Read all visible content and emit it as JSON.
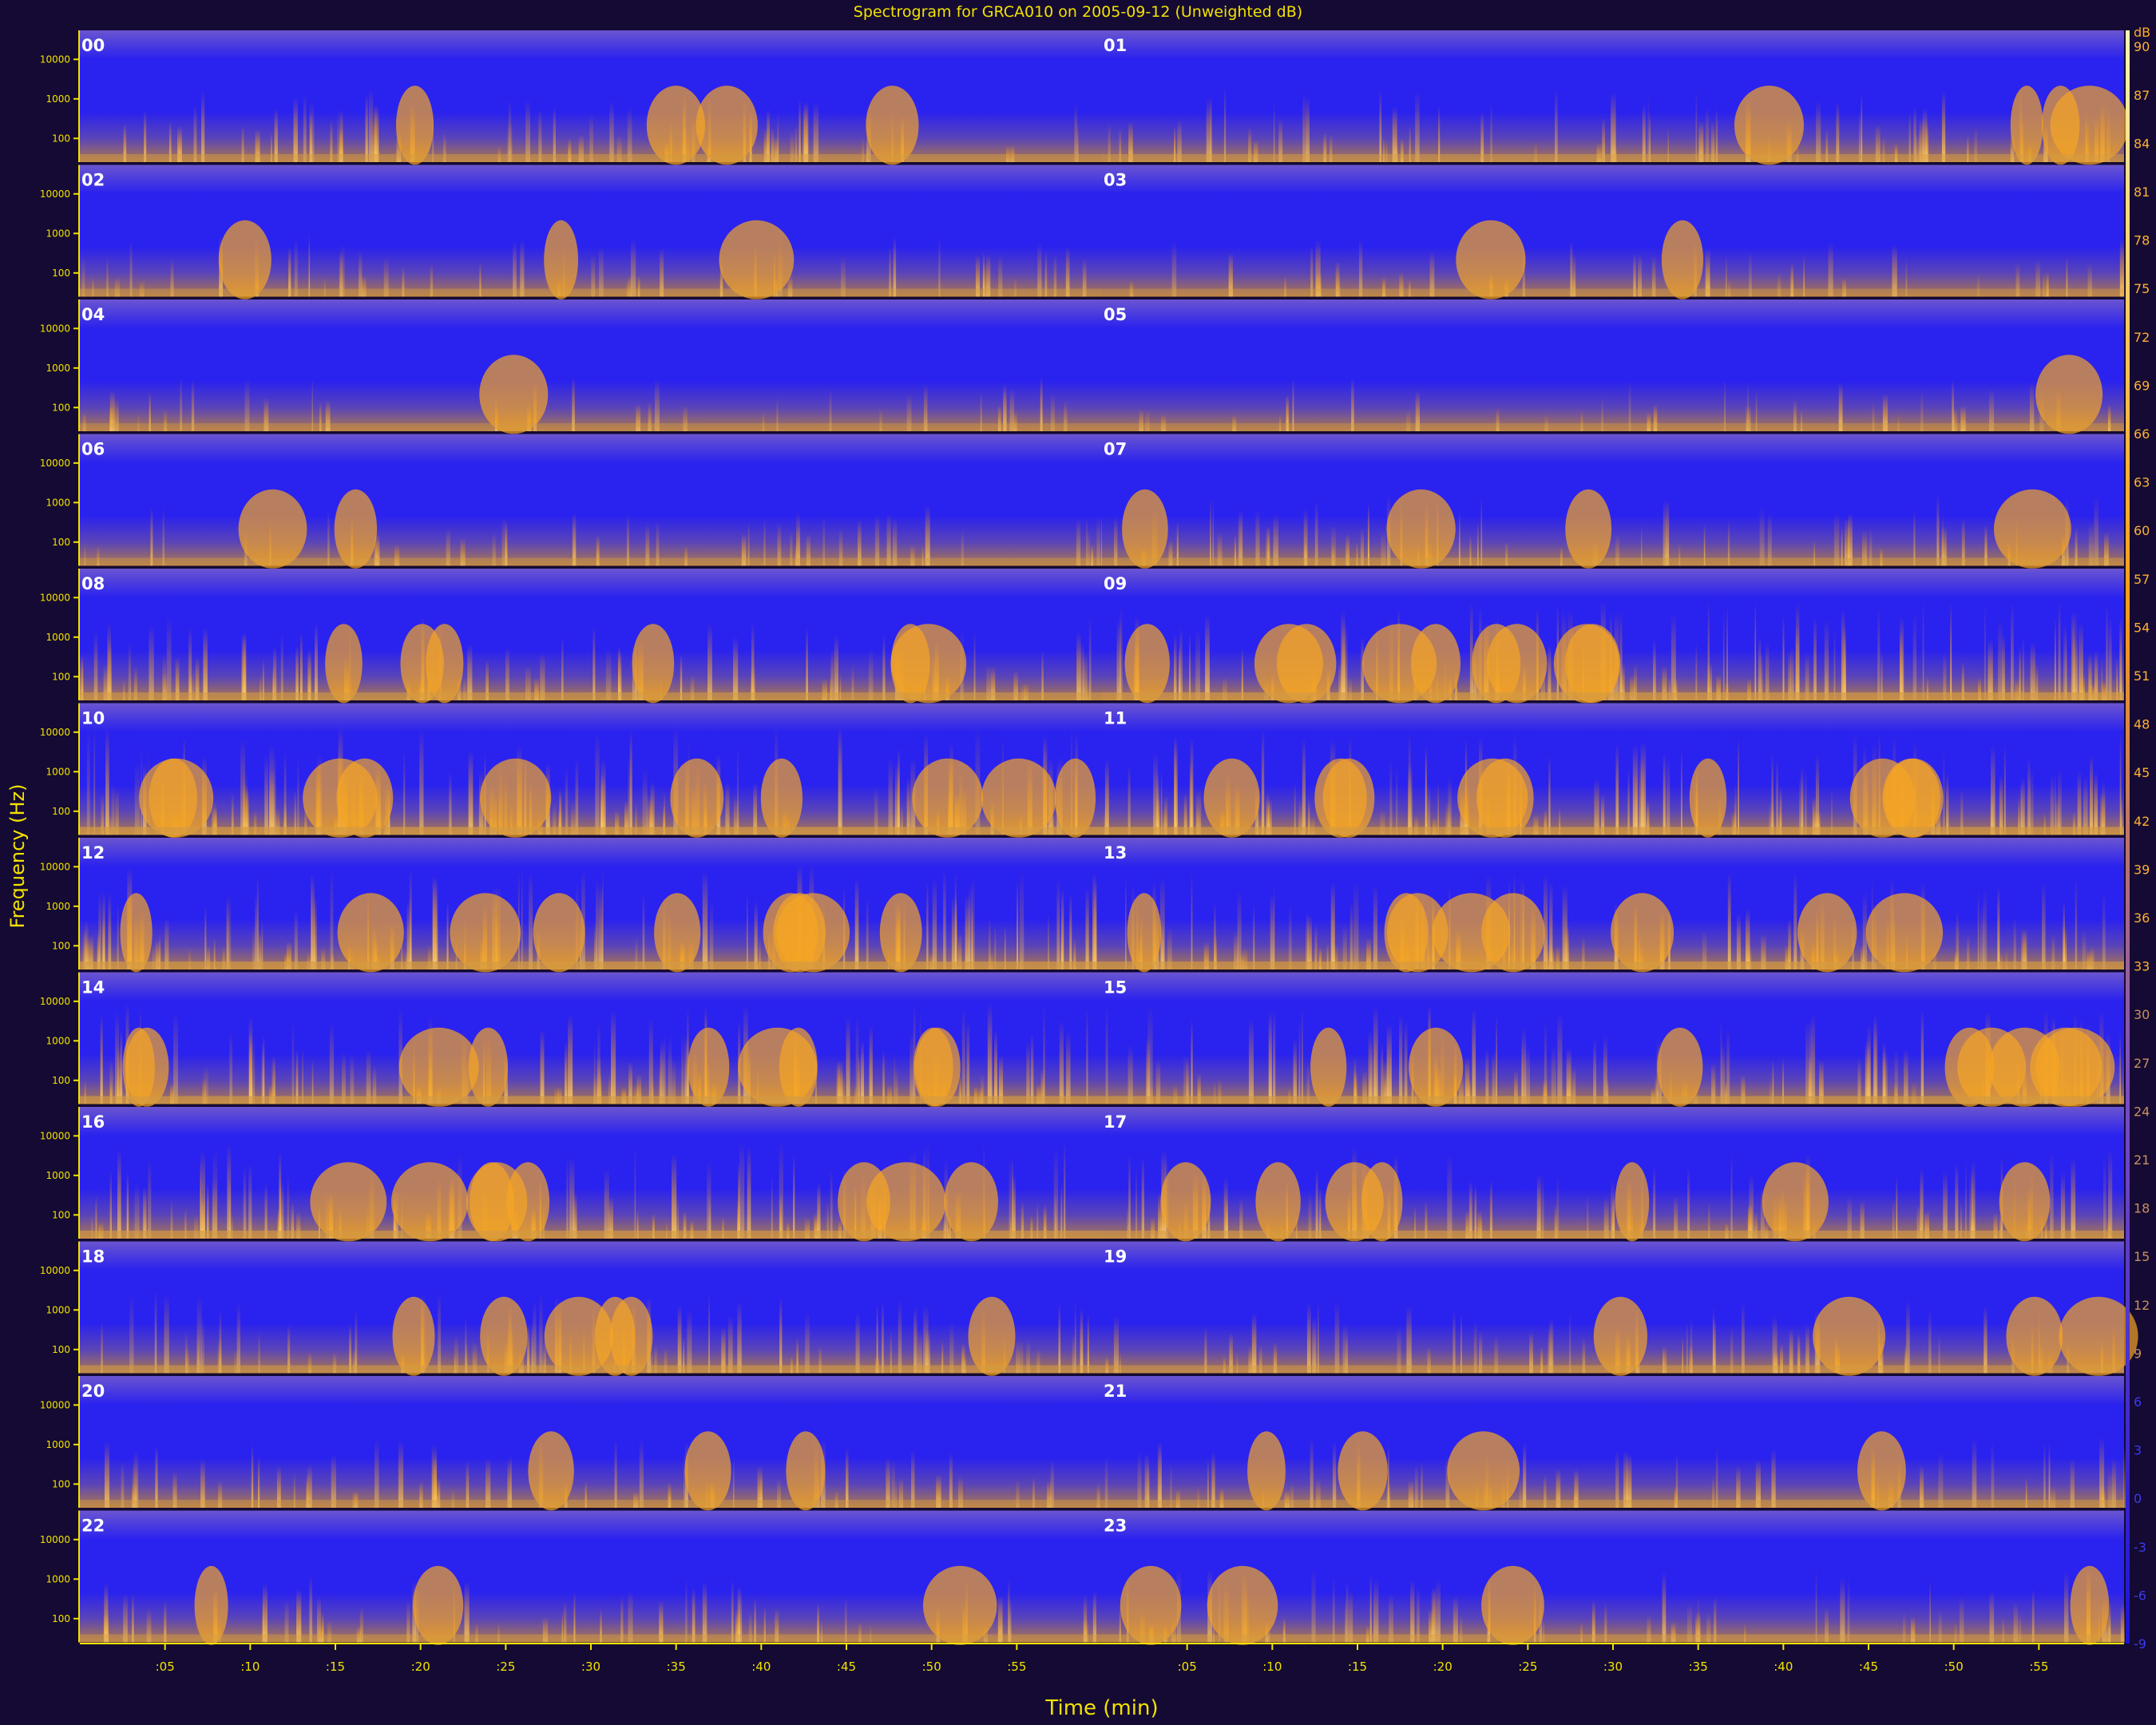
{
  "chart_data": {
    "type": "heatmap",
    "title": "Spectrogram for GRCA010 on 2005-09-12 (Unweighted dB)",
    "xlabel": "Time (min)",
    "ylabel": "Frequency (Hz)",
    "colorbar_unit": "dB",
    "y_tick_labels": [
      "10000",
      "1000",
      "100"
    ],
    "x_tick_labels": [
      ":05",
      ":10",
      ":15",
      ":20",
      ":25",
      ":30",
      ":35",
      ":40",
      ":45",
      ":50",
      ":55"
    ],
    "colorbar_ticks": [
      90,
      87,
      84,
      81,
      78,
      75,
      72,
      69,
      66,
      63,
      60,
      57,
      54,
      51,
      48,
      45,
      42,
      39,
      36,
      33,
      30,
      27,
      24,
      21,
      18,
      15,
      12,
      9,
      6,
      3,
      0,
      -3,
      -6,
      -9
    ],
    "colorbar_range": [
      -9,
      91
    ],
    "panels": [
      {
        "hour": "00",
        "mean_level": 0.28
      },
      {
        "hour": "01",
        "mean_level": 0.32
      },
      {
        "hour": "02",
        "mean_level": 0.18
      },
      {
        "hour": "03",
        "mean_level": 0.12
      },
      {
        "hour": "04",
        "mean_level": 0.08
      },
      {
        "hour": "05",
        "mean_level": 0.08
      },
      {
        "hour": "06",
        "mean_level": 0.14
      },
      {
        "hour": "07",
        "mean_level": 0.28
      },
      {
        "hour": "08",
        "mean_level": 0.42
      },
      {
        "hour": "09",
        "mean_level": 0.62
      },
      {
        "hour": "10",
        "mean_level": 0.72
      },
      {
        "hour": "11",
        "mean_level": 0.66
      },
      {
        "hour": "12",
        "mean_level": 0.66
      },
      {
        "hour": "13",
        "mean_level": 0.58
      },
      {
        "hour": "14",
        "mean_level": 0.62
      },
      {
        "hour": "15",
        "mean_level": 0.6
      },
      {
        "hour": "16",
        "mean_level": 0.58
      },
      {
        "hour": "17",
        "mean_level": 0.5
      },
      {
        "hour": "18",
        "mean_level": 0.4
      },
      {
        "hour": "19",
        "mean_level": 0.3
      },
      {
        "hour": "20",
        "mean_level": 0.24
      },
      {
        "hour": "21",
        "mean_level": 0.26
      },
      {
        "hour": "22",
        "mean_level": 0.22
      },
      {
        "hour": "23",
        "mean_level": 0.3
      }
    ]
  }
}
